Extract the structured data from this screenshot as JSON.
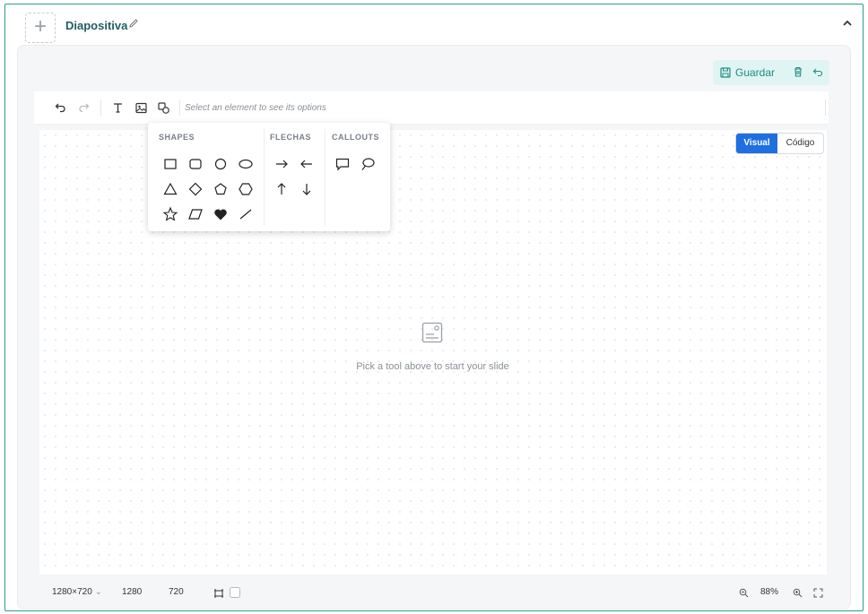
{
  "header": {
    "title": "Diapositiva",
    "add_icon": "plus-icon",
    "edit_icon": "pencil-icon",
    "collapse_icon": "chevron-up-icon"
  },
  "actions": {
    "save_label": "Guardar",
    "delete_icon": "trash-icon",
    "undo_icon": "return-icon"
  },
  "toolbar": {
    "hint": "Select an element to see its options"
  },
  "view_toggle": {
    "visual": "Visual",
    "code": "Código"
  },
  "canvas": {
    "empty_text": "Pick a tool above to start your slide"
  },
  "shapes_menu": {
    "headers": {
      "shapes": "SHAPES",
      "arrows": "FLECHAS",
      "callouts": "CALLOUTS"
    },
    "shapes": [
      "rectangle",
      "rounded-rectangle",
      "circle",
      "ellipse",
      "triangle",
      "diamond",
      "pentagon",
      "hexagon",
      "star",
      "parallelogram",
      "heart",
      "line"
    ],
    "arrows": [
      "arrow-right",
      "arrow-left",
      "arrow-up",
      "arrow-down"
    ],
    "callouts": [
      "speech-bubble",
      "thought-bubble"
    ]
  },
  "statusbar": {
    "size_preset": "1280×720",
    "width": "1280",
    "height": "720",
    "zoom": "88%"
  },
  "colors": {
    "accent": "#1f6fe0",
    "teal": "#1f8a80",
    "border": "#2a9d8f"
  }
}
